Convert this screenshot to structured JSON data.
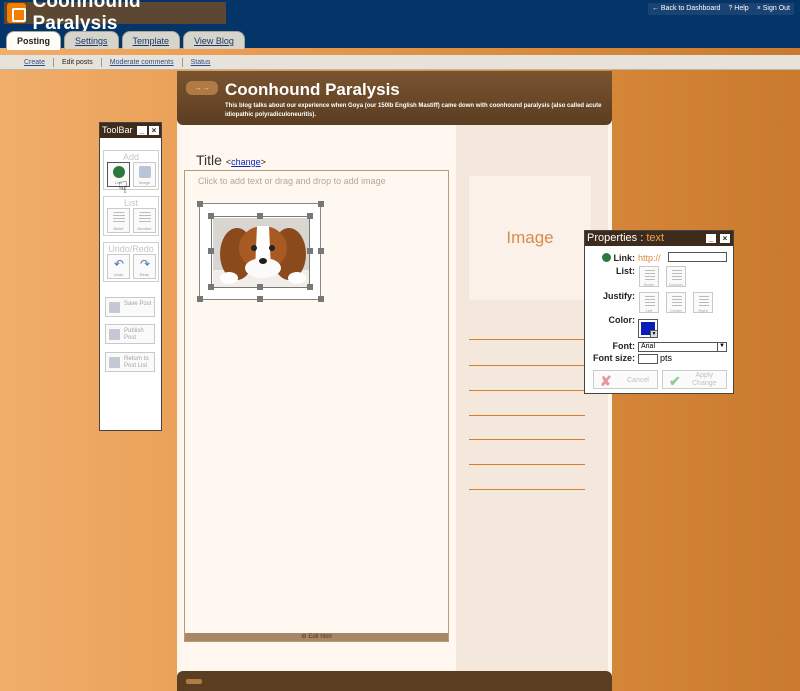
{
  "colors": {
    "topbar": "#043568",
    "brown": "#5b3d21",
    "accent": "#f1a252",
    "selected_color": "#0c1cb8"
  },
  "header": {
    "title": "Coonhound Paralysis",
    "logo": "blogger-logo-icon"
  },
  "top_links": {
    "dashboard": "Back to Dashboard",
    "help": "Help",
    "signout": "Sign Out"
  },
  "tabs": [
    {
      "label": "Posting"
    },
    {
      "label": "Settings"
    },
    {
      "label": "Template"
    },
    {
      "label": "View Blog"
    }
  ],
  "subnav": [
    {
      "label": "Create"
    },
    {
      "label": "Edit posts"
    },
    {
      "label": "Moderate comments"
    },
    {
      "label": "Status"
    }
  ],
  "blog": {
    "title": "Coonhound Paralysis",
    "description": "This blog talks about our experience when Goya (our 150lb English Mastiff) came down with coonhound paralysis (also called acute idiopathic polyradiculoneuritis).",
    "arrow_icon": "arrow-icon"
  },
  "post": {
    "title_label": "Title",
    "change_open": "<",
    "change_link": "change",
    "change_close": ">",
    "placeholder": "Click to add text or drag and drop to add image",
    "edit_html": "Edit html"
  },
  "sidebar": {
    "image_label": "Image"
  },
  "toolbar": {
    "title": "ToolBar",
    "add_label": "Add",
    "add_items": [
      {
        "label": "Link",
        "icon": "globe-link-icon"
      },
      {
        "label": "Image",
        "icon": "image-icon"
      }
    ],
    "list_label": "List",
    "list_items": [
      {
        "label": "Bullet"
      },
      {
        "label": "Number"
      }
    ],
    "undo_label": "Undo/Redo",
    "undo_items": [
      {
        "label": "Undo"
      },
      {
        "label": "Redo"
      }
    ],
    "actions": [
      {
        "line1": "Save Post",
        "line2": ""
      },
      {
        "line1": "Publish",
        "line2": "Post"
      },
      {
        "line1": "Return to",
        "line2": "Post List"
      }
    ]
  },
  "properties": {
    "title": "Properties : ",
    "title_accent": "text",
    "link_label": "Link:",
    "link_prefix": "http://",
    "link_value": "",
    "list_label": "List:",
    "list_items": [
      {
        "label": "Bullet"
      },
      {
        "label": "Number"
      }
    ],
    "justify_label": "Justify:",
    "justify_items": [
      {
        "label": "Left"
      },
      {
        "label": "Center"
      },
      {
        "label": "Right"
      }
    ],
    "color_label": "Color:",
    "font_label": "Font:",
    "font_value": "Arial",
    "size_label": "Font size:",
    "size_value": "",
    "size_unit": "pts",
    "cancel_label": "Cancel",
    "apply_line1": "Apply",
    "apply_line2": "Change"
  }
}
